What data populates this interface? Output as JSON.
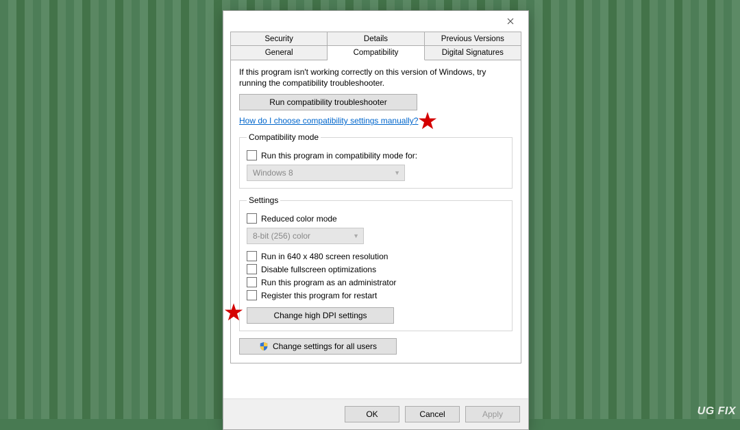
{
  "tabs": {
    "row1": [
      "Security",
      "Details",
      "Previous Versions"
    ],
    "row2": [
      "General",
      "Compatibility",
      "Digital Signatures"
    ],
    "active": "Compatibility"
  },
  "intro": "If this program isn't working correctly on this version of Windows, try running the compatibility troubleshooter.",
  "run_troubleshooter": "Run compatibility troubleshooter",
  "help_link": "How do I choose compatibility settings manually?",
  "compat_group": {
    "legend": "Compatibility mode",
    "checkbox": "Run this program in compatibility mode for:",
    "combo": "Windows 8"
  },
  "settings_group": {
    "legend": "Settings",
    "reduced_color": "Reduced color mode",
    "color_combo": "8-bit (256) color",
    "run_640": "Run in 640 x 480 screen resolution",
    "disable_fullscreen": "Disable fullscreen optimizations",
    "run_admin": "Run this program as an administrator",
    "register_restart": "Register this program for restart",
    "dpi_button": "Change high DPI settings"
  },
  "all_users_button": "Change settings for all users",
  "footer": {
    "ok": "OK",
    "cancel": "Cancel",
    "apply": "Apply"
  },
  "watermark": "UG   FIX"
}
